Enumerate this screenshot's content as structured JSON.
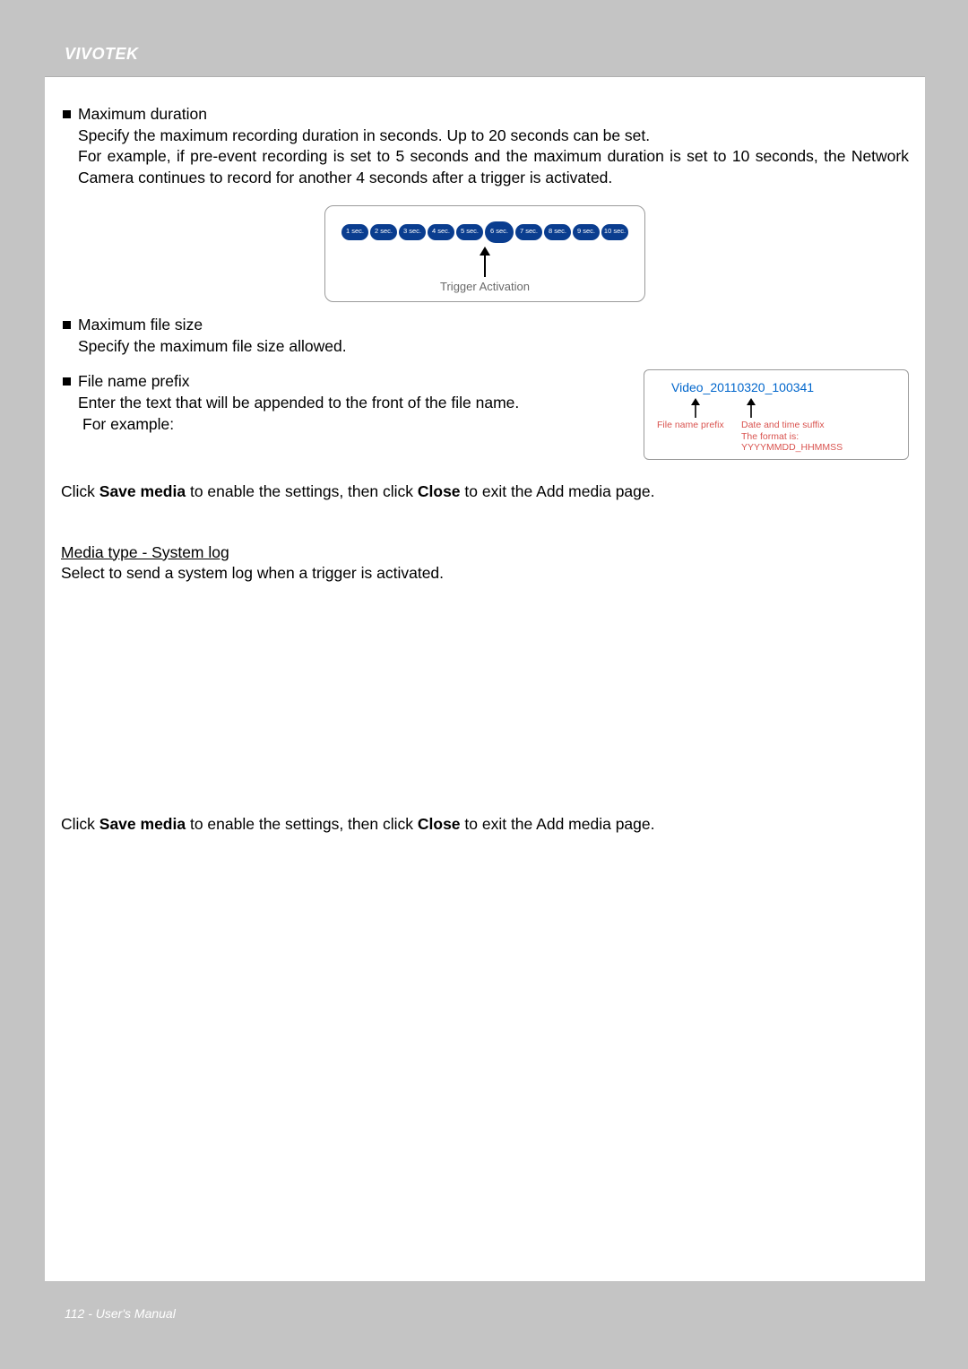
{
  "brand": "VIVOTEK",
  "sections": {
    "maxDuration": {
      "title": "Maximum duration",
      "line1": "Specify the maximum recording duration in seconds. Up to 20 seconds can be set.",
      "line2": "For example, if pre-event recording is set to 5 seconds and the maximum duration is set to 10 seconds, the Network Camera continues to record for another 4 seconds after a trigger is activated."
    },
    "diagram": {
      "pills": [
        "1 sec.",
        "2 sec.",
        "3 sec.",
        "4 sec.",
        "5 sec.",
        "6 sec.",
        "7 sec.",
        "8 sec.",
        "9 sec.",
        "10 sec."
      ],
      "activeIndex": 5,
      "label": "Trigger Activation"
    },
    "maxFileSize": {
      "title": "Maximum file size",
      "desc": "Specify the maximum file size allowed."
    },
    "filePrefix": {
      "title": "File name prefix",
      "desc": "Enter the text that will be appended to the front of the file name.",
      "example": "For example:"
    },
    "filenameBox": {
      "sample": "Video_20110320_100341",
      "prefixLabel": "File name prefix",
      "suffixLabel": "Date and time suffix",
      "formatLabel": "The format is: YYYYMMDD_HHMMSS"
    },
    "saveLine1_a": "Click ",
    "saveLine1_b": "Save media",
    "saveLine1_c": " to enable the settings, then click ",
    "saveLine1_d": "Close",
    "saveLine1_e": " to exit the Add media page.",
    "mediaTypeHeading": "Media type - System log",
    "mediaTypeDesc": "Select to send a system log when a trigger is activated."
  },
  "footer": {
    "page": "112",
    "sep": " - ",
    "label": "User's Manual"
  }
}
